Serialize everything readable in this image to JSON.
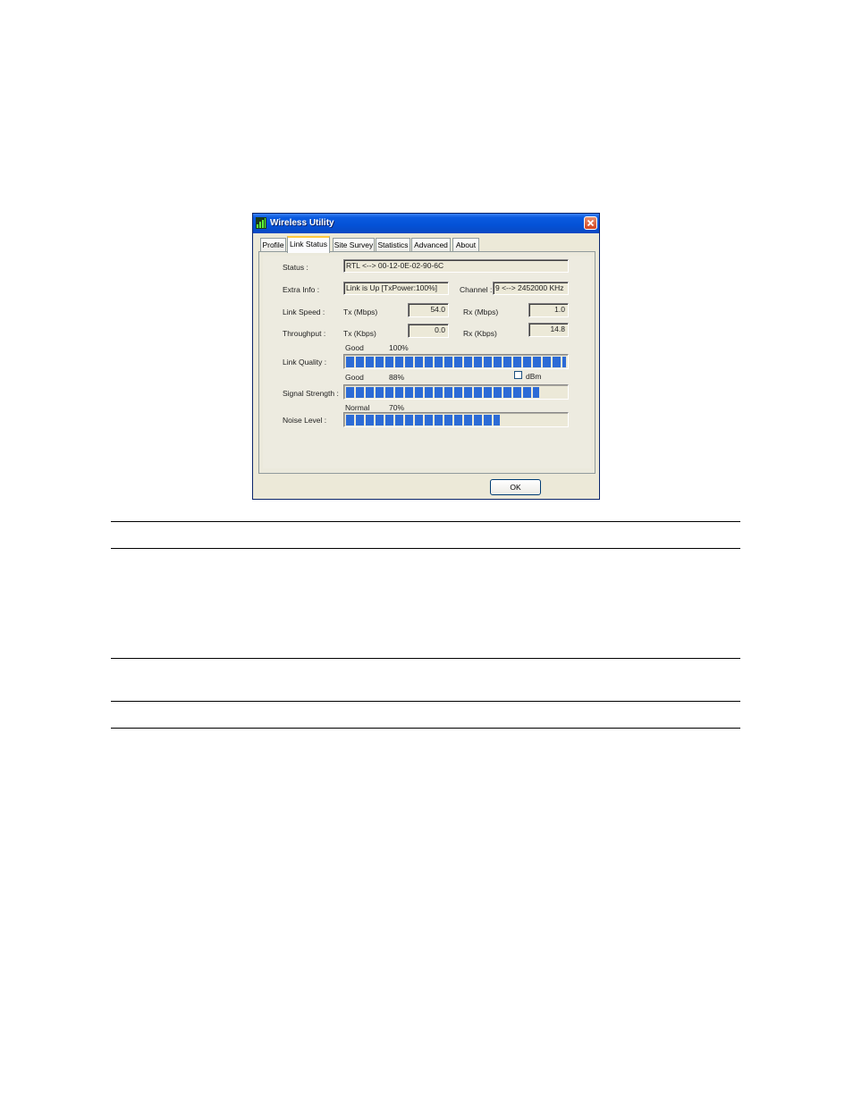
{
  "window": {
    "title": "Wireless Utility"
  },
  "tabs": [
    {
      "label": "Profile",
      "active": false
    },
    {
      "label": "Link Status",
      "active": true
    },
    {
      "label": "Site Survey",
      "active": false
    },
    {
      "label": "Statistics",
      "active": false
    },
    {
      "label": "Advanced",
      "active": false
    },
    {
      "label": "About",
      "active": false
    }
  ],
  "link_status": {
    "status_label": "Status :",
    "status_value": "RTL <--> 00-12-0E-02-90-6C",
    "extra_info_label": "Extra Info :",
    "extra_info_value": "Link is Up [TxPower:100%]",
    "channel_label": "Channel :",
    "channel_value": "9 <--> 2452000 KHz",
    "link_speed_label": "Link Speed :",
    "throughput_label": "Throughput :",
    "tx_mbps_label": "Tx (Mbps)",
    "tx_mbps_value": "54.0",
    "rx_mbps_label": "Rx (Mbps)",
    "rx_mbps_value": "1.0",
    "tx_kbps_label": "Tx (Kbps)",
    "tx_kbps_value": "0.0",
    "rx_kbps_label": "Rx (Kbps)",
    "rx_kbps_value": "14.8",
    "link_quality": {
      "label": "Link Quality :",
      "status": "Good",
      "percent_text": "100%",
      "level": 1.0
    },
    "signal_strength": {
      "label": "Signal Strength :",
      "status": "Good",
      "percent_text": "88%",
      "level": 0.88
    },
    "noise_level": {
      "label": "Noise Level :",
      "status": "Normal",
      "percent_text": "70%",
      "level": 0.7
    },
    "dbm_label": "dBm",
    "dbm_checked": false
  },
  "buttons": {
    "ok_label": "OK"
  },
  "colors": {
    "bar_fill": "#2c6bd6",
    "title_bar": "#0451d6",
    "close_button": "#d2421d"
  },
  "icons": {
    "app": "wireless-signal-icon",
    "close": "close-icon"
  }
}
